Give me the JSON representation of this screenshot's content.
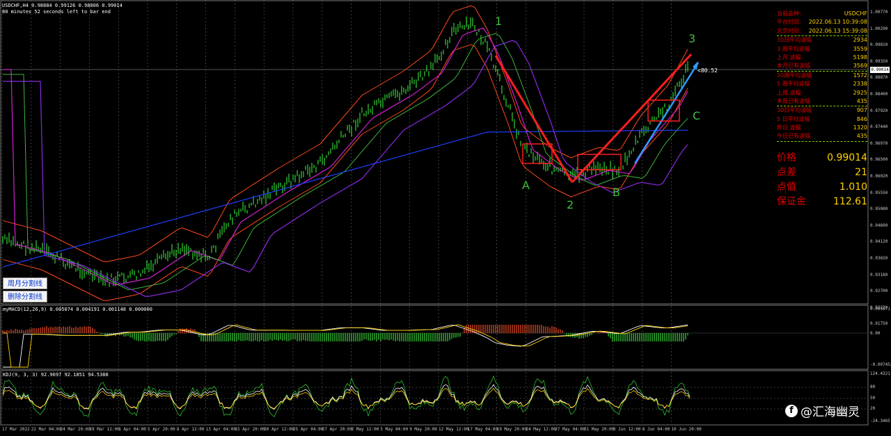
{
  "window": {
    "symbol_line": "USDCHF,H4  0.98884 0.99126 0.98806 0.99014",
    "timer_line": "80 minutes 52 seconds left to bar end",
    "cursor_readout": "<80.52",
    "current_price_tag": "0.99014"
  },
  "buttons": {
    "week_month_split": "周月分割线",
    "delete_split": "删除分割线"
  },
  "info_panel": {
    "rows": [
      {
        "label": "当前品种:",
        "value": "USDCHF"
      },
      {
        "label": "平台时间:",
        "value": "2022.06.13 10:39:08"
      },
      {
        "label": "北京时间:",
        "value": "2022.06.13 15:39:08"
      },
      {
        "label": "30日平均波幅",
        "value": "2934"
      },
      {
        "label": "3 周平均波幅",
        "value": "3559"
      },
      {
        "label": "上月    波幅",
        "value": "5198"
      },
      {
        "label": "本月已有波幅",
        "value": "3569"
      },
      {
        "label": "30周平均波幅",
        "value": "1572"
      },
      {
        "label": "5 周平均波幅",
        "value": "2338"
      },
      {
        "label": "上周    波幅",
        "value": "2925"
      },
      {
        "label": "本周已有波幅",
        "value": "435"
      },
      {
        "label": "30日平均波幅",
        "value": "907"
      },
      {
        "label": "5 日平均波幅",
        "value": "846"
      },
      {
        "label": "昨日    波幅",
        "value": "1320"
      },
      {
        "label": "今日已有波幅",
        "value": "435"
      }
    ],
    "big_rows": [
      {
        "label": "价格",
        "value": "0.99014"
      },
      {
        "label": "点差",
        "value": "21"
      },
      {
        "label": "点值",
        "value": "1.010"
      },
      {
        "label": "保证金",
        "value": "112.61"
      }
    ]
  },
  "wave_labels": {
    "w1": "1",
    "w2": "2",
    "w3": "3",
    "wA": "A",
    "wB": "B",
    "wC": "C"
  },
  "price_axis": [
    "1.00770",
    "1.00290",
    "0.99810",
    "0.99350",
    "0.98870",
    "0.98400",
    "0.97920",
    "0.97440",
    "0.96970",
    "0.96500",
    "0.96020",
    "0.95550",
    "0.95080",
    "0.94600",
    "0.94120",
    "0.93650",
    "0.93180",
    "0.92700",
    "0.92230",
    "0.91750"
  ],
  "macd": {
    "header": "myMACD(12,26,9) 0.005074 0.004191 0.001148 0.000000",
    "axis": [
      "0.005671",
      "0.00",
      "-0.007452"
    ]
  },
  "kdj": {
    "header": "KDJ(9, 3, 3) 92.9697 92.1851 94.5388",
    "axis": [
      "124.4321",
      "80",
      "50",
      "20",
      "-24.3465"
    ]
  },
  "time_axis": [
    "17 Mar 2022",
    "22 Mar 04:00",
    "24 Mar 20:00",
    "29 Mar 12:00",
    "1 Apr 04:00",
    "5 Apr 20:00",
    "8 Apr 12:00",
    "13 Apr 04:00",
    "15 Apr 20:00",
    "20 Apr 12:00",
    "25 Apr 04:00",
    "27 Apr 20:00",
    "2 May 12:00",
    "5 May 04:00",
    "9 May 20:00",
    "12 May 12:00",
    "17 May 04:00",
    "19 May 20:00",
    "24 May 12:00",
    "27 May 04:00",
    "31 May 20:00",
    "3 Jun 12:00",
    "8 Jun 04:00",
    "10 Jun 20:00"
  ],
  "watermark": {
    "brand": "@汇海幽灵",
    "icon": "facebook-icon"
  },
  "colors": {
    "candles": "#3cff3c",
    "bollinger": "#ff4a1a",
    "ma_magenta": "#d020d0",
    "ma_green": "#3cb43c",
    "ma_purple": "#8a2be2",
    "ma_blue": "#1f3fff",
    "trend_red": "#ff1e1e",
    "trend_blue": "#2e9bff",
    "label_red": "#e00000",
    "value_yellow": "#ffd200"
  }
}
